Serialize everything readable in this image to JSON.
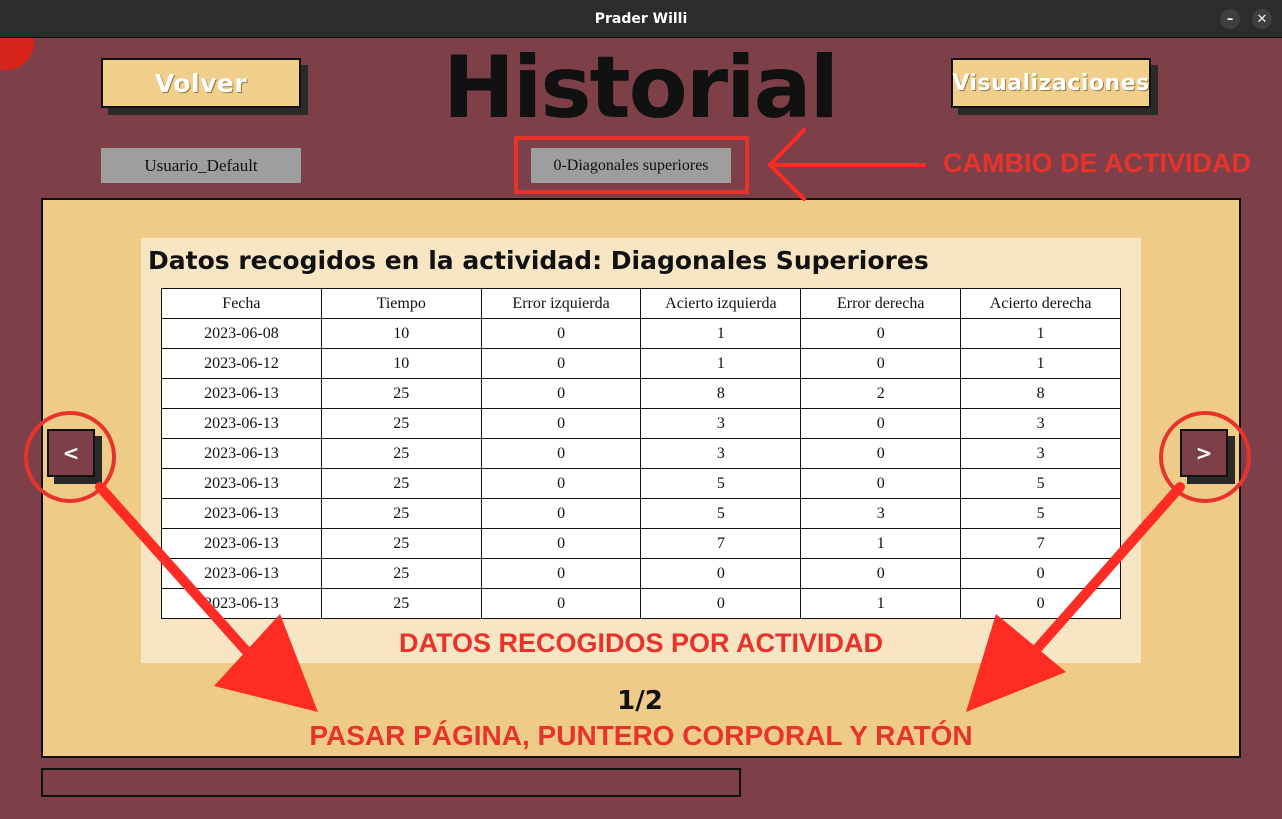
{
  "window": {
    "title": "Prader Willi",
    "min_glyph": "–",
    "close_glyph": "✕"
  },
  "header": {
    "back_label": "Volver",
    "title": "Historial",
    "visual_label": "Visualizaciones"
  },
  "selectors": {
    "user": "Usuario_Default",
    "activity": "0-Diagonales superiores"
  },
  "annotations": {
    "change_activity": "CAMBIO DE ACTIVIDAD",
    "data_per_activity": "DATOS RECOGIDOS POR ACTIVIDAD",
    "page_turn": "PASAR PÁGINA, PUNTERO CORPORAL Y RATÓN"
  },
  "panel": {
    "title": "Datos recogidos en la actividad: Diagonales Superiores",
    "columns": [
      "Fecha",
      "Tiempo",
      "Error izquierda",
      "Acierto izquierda",
      "Error derecha",
      "Acierto derecha"
    ],
    "rows": [
      [
        "2023-06-08",
        "10",
        "0",
        "1",
        "0",
        "1"
      ],
      [
        "2023-06-12",
        "10",
        "0",
        "1",
        "0",
        "1"
      ],
      [
        "2023-06-13",
        "25",
        "0",
        "8",
        "2",
        "8"
      ],
      [
        "2023-06-13",
        "25",
        "0",
        "3",
        "0",
        "3"
      ],
      [
        "2023-06-13",
        "25",
        "0",
        "3",
        "0",
        "3"
      ],
      [
        "2023-06-13",
        "25",
        "0",
        "5",
        "0",
        "5"
      ],
      [
        "2023-06-13",
        "25",
        "0",
        "5",
        "3",
        "5"
      ],
      [
        "2023-06-13",
        "25",
        "0",
        "7",
        "1",
        "7"
      ],
      [
        "2023-06-13",
        "25",
        "0",
        "0",
        "0",
        "0"
      ],
      [
        "2023-06-13",
        "25",
        "0",
        "0",
        "1",
        "0"
      ]
    ],
    "prev_label": "<",
    "next_label": ">",
    "page": "1/2"
  },
  "colors": {
    "background": "#7d3f48",
    "panel": "#efcb88",
    "button": "#f0cf8d",
    "annotation": "#e8332d"
  }
}
